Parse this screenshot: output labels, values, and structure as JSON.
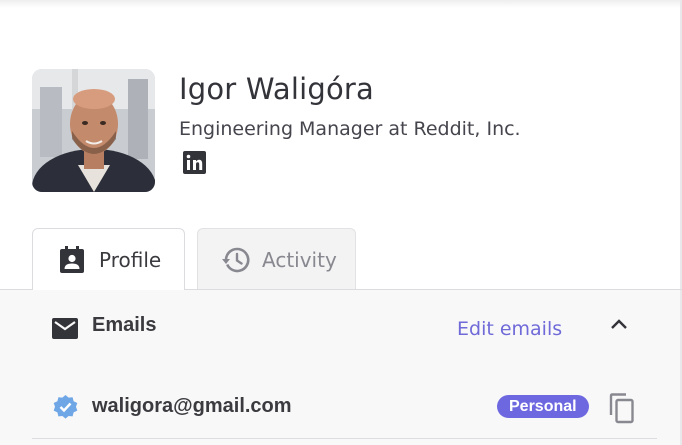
{
  "profile": {
    "name": "Igor Waligóra",
    "headline": "Engineering Manager at Reddit, Inc.",
    "social_icon": "linkedin-icon"
  },
  "tabs": [
    {
      "label": "Profile",
      "icon": "calendar-user-icon",
      "active": true
    },
    {
      "label": "Activity",
      "icon": "history-icon",
      "active": false
    }
  ],
  "emails_section": {
    "title": "Emails",
    "icon": "mail-icon",
    "edit_label": "Edit emails",
    "collapse_icon": "chevron-up-icon",
    "items": [
      {
        "address": "waligora@gmail.com",
        "type_label": "Personal",
        "verified_icon": "verified-badge-icon",
        "copy_icon": "copy-icon"
      }
    ]
  },
  "colors": {
    "accent": "#6d68e0",
    "link": "#6f6ad8",
    "text": "#3a3a3f",
    "verified": "#6fa7e6"
  }
}
